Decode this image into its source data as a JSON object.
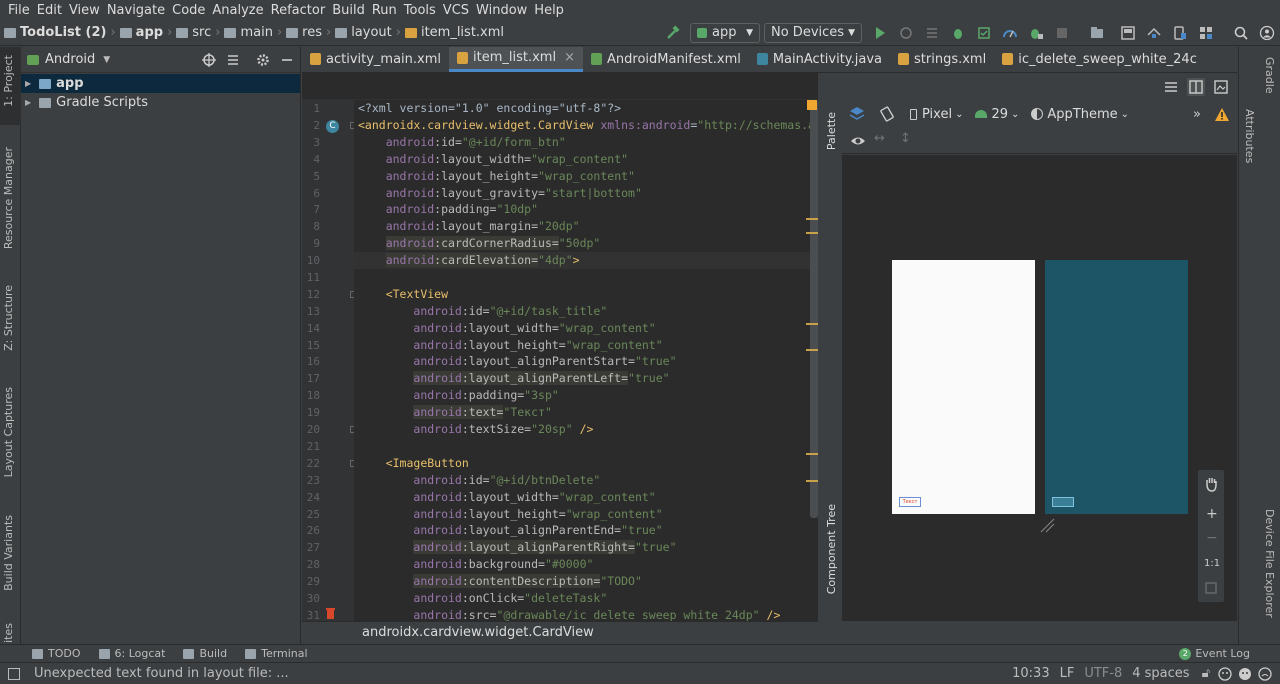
{
  "menu": [
    "File",
    "Edit",
    "View",
    "Navigate",
    "Code",
    "Analyze",
    "Refactor",
    "Build",
    "Run",
    "Tools",
    "VCS",
    "Window",
    "Help"
  ],
  "nav": {
    "crumbs": [
      "TodoList (2)",
      "app",
      "src",
      "main",
      "res",
      "layout",
      "item_list.xml"
    ],
    "run_config": "app",
    "devices": "No Devices"
  },
  "left_tabs": [
    "1: Project",
    "Resource Manager",
    "Z: Structure",
    "Layout Captures",
    "Build Variants",
    "ites"
  ],
  "project": {
    "view_label": "Android",
    "tree": [
      {
        "label": "app",
        "bold": true
      },
      {
        "label": "Gradle Scripts",
        "bold": false
      }
    ]
  },
  "tabs": [
    {
      "label": "activity_main.xml",
      "color": "#d8a241"
    },
    {
      "label": "item_list.xml",
      "color": "#d8a241",
      "active": true
    },
    {
      "label": "AndroidManifest.xml",
      "color": "#62a155"
    },
    {
      "label": "MainActivity.java",
      "color": "#3e86a0"
    },
    {
      "label": "strings.xml",
      "color": "#d8a241"
    },
    {
      "label": "ic_delete_sweep_white_24c",
      "color": "#d8a241"
    }
  ],
  "code_lines": [
    {
      "n": "1",
      "parts": [
        [
          "pl",
          "<?xml version=\"1.0\" encoding=\"utf-8\"?>"
        ]
      ]
    },
    {
      "n": "2",
      "parts": [
        [
          "tg",
          "<androidx.cardview.widget.CardView "
        ],
        [
          "ns",
          "xmlns:android"
        ],
        [
          "pl",
          "="
        ],
        [
          "str",
          "\"http://schemas.andro"
        ]
      ]
    },
    {
      "n": "3",
      "parts": [
        [
          "pl",
          "    "
        ],
        [
          "ns",
          "android"
        ],
        [
          "at",
          ":id="
        ],
        [
          "str",
          "\"@+id/form_btn\""
        ]
      ]
    },
    {
      "n": "4",
      "parts": [
        [
          "pl",
          "    "
        ],
        [
          "ns",
          "android"
        ],
        [
          "at",
          ":layout_width="
        ],
        [
          "str",
          "\"wrap_content\""
        ]
      ]
    },
    {
      "n": "5",
      "parts": [
        [
          "pl",
          "    "
        ],
        [
          "ns",
          "android"
        ],
        [
          "at",
          ":layout_height="
        ],
        [
          "str",
          "\"wrap_content\""
        ]
      ]
    },
    {
      "n": "6",
      "parts": [
        [
          "pl",
          "    "
        ],
        [
          "ns",
          "android"
        ],
        [
          "at",
          ":layout_gravity="
        ],
        [
          "str",
          "\"start|bottom\""
        ]
      ]
    },
    {
      "n": "7",
      "parts": [
        [
          "pl",
          "    "
        ],
        [
          "ns",
          "android"
        ],
        [
          "at",
          ":padding="
        ],
        [
          "str",
          "\"10dp\""
        ]
      ]
    },
    {
      "n": "8",
      "parts": [
        [
          "pl",
          "    "
        ],
        [
          "ns",
          "android"
        ],
        [
          "at",
          ":layout_margin="
        ],
        [
          "str",
          "\"20dp\""
        ]
      ]
    },
    {
      "n": "9",
      "parts": [
        [
          "pl",
          "    "
        ],
        [
          "ns",
          "android"
        ],
        [
          "at",
          ":cardCornerRadius="
        ],
        [
          "str",
          "\"50dp\""
        ]
      ],
      "hl": true
    },
    {
      "n": "10",
      "parts": [
        [
          "pl",
          "    "
        ],
        [
          "ns",
          "android"
        ],
        [
          "at",
          ":cardElevation="
        ],
        [
          "str",
          "\"4dp\""
        ],
        [
          "tg",
          ">"
        ]
      ],
      "hl": true
    },
    {
      "n": "11",
      "parts": []
    },
    {
      "n": "12",
      "parts": [
        [
          "pl",
          "    "
        ],
        [
          "tg",
          "<TextView"
        ]
      ]
    },
    {
      "n": "13",
      "parts": [
        [
          "pl",
          "        "
        ],
        [
          "ns",
          "android"
        ],
        [
          "at",
          ":id="
        ],
        [
          "str",
          "\"@+id/task_title\""
        ]
      ]
    },
    {
      "n": "14",
      "parts": [
        [
          "pl",
          "        "
        ],
        [
          "ns",
          "android"
        ],
        [
          "at",
          ":layout_width="
        ],
        [
          "str",
          "\"wrap_content\""
        ]
      ]
    },
    {
      "n": "15",
      "parts": [
        [
          "pl",
          "        "
        ],
        [
          "ns",
          "android"
        ],
        [
          "at",
          ":layout_height="
        ],
        [
          "str",
          "\"wrap_content\""
        ]
      ]
    },
    {
      "n": "16",
      "parts": [
        [
          "pl",
          "        "
        ],
        [
          "ns",
          "android"
        ],
        [
          "at",
          ":layout_alignParentStart="
        ],
        [
          "str",
          "\"true\""
        ]
      ]
    },
    {
      "n": "17",
      "parts": [
        [
          "pl",
          "        "
        ],
        [
          "ns",
          "android"
        ],
        [
          "at",
          ":layout_alignParentLeft="
        ],
        [
          "str",
          "\"true\""
        ]
      ],
      "hl": true
    },
    {
      "n": "18",
      "parts": [
        [
          "pl",
          "        "
        ],
        [
          "ns",
          "android"
        ],
        [
          "at",
          ":padding="
        ],
        [
          "str",
          "\"3sp\""
        ]
      ]
    },
    {
      "n": "19",
      "parts": [
        [
          "pl",
          "        "
        ],
        [
          "ns",
          "android"
        ],
        [
          "at",
          ":text="
        ],
        [
          "str",
          "\"Текст\""
        ]
      ],
      "hl": true
    },
    {
      "n": "20",
      "parts": [
        [
          "pl",
          "        "
        ],
        [
          "ns",
          "android"
        ],
        [
          "at",
          ":textSize="
        ],
        [
          "str",
          "\"20sp\""
        ],
        [
          "tg",
          " />"
        ]
      ]
    },
    {
      "n": "21",
      "parts": []
    },
    {
      "n": "22",
      "parts": [
        [
          "pl",
          "    "
        ],
        [
          "tg",
          "<ImageButton"
        ]
      ]
    },
    {
      "n": "23",
      "parts": [
        [
          "pl",
          "        "
        ],
        [
          "ns",
          "android"
        ],
        [
          "at",
          ":id="
        ],
        [
          "str",
          "\"@+id/btnDelete\""
        ]
      ]
    },
    {
      "n": "24",
      "parts": [
        [
          "pl",
          "        "
        ],
        [
          "ns",
          "android"
        ],
        [
          "at",
          ":layout_width="
        ],
        [
          "str",
          "\"wrap_content\""
        ]
      ]
    },
    {
      "n": "25",
      "parts": [
        [
          "pl",
          "        "
        ],
        [
          "ns",
          "android"
        ],
        [
          "at",
          ":layout_height="
        ],
        [
          "str",
          "\"wrap_content\""
        ]
      ]
    },
    {
      "n": "26",
      "parts": [
        [
          "pl",
          "        "
        ],
        [
          "ns",
          "android"
        ],
        [
          "at",
          ":layout_alignParentEnd="
        ],
        [
          "str",
          "\"true\""
        ]
      ]
    },
    {
      "n": "27",
      "parts": [
        [
          "pl",
          "        "
        ],
        [
          "ns",
          "android"
        ],
        [
          "at",
          ":layout_alignParentRight="
        ],
        [
          "str",
          "\"true\""
        ]
      ],
      "hl": true
    },
    {
      "n": "28",
      "parts": [
        [
          "pl",
          "        "
        ],
        [
          "ns",
          "android"
        ],
        [
          "at",
          ":background="
        ],
        [
          "str",
          "\"#0000\""
        ]
      ]
    },
    {
      "n": "29",
      "parts": [
        [
          "pl",
          "        "
        ],
        [
          "ns",
          "android"
        ],
        [
          "at",
          ":contentDescription="
        ],
        [
          "str",
          "\"TODO\""
        ]
      ],
      "hl": true
    },
    {
      "n": "30",
      "parts": [
        [
          "pl",
          "        "
        ],
        [
          "ns",
          "android"
        ],
        [
          "at",
          ":onClick="
        ],
        [
          "str",
          "\"deleteTask\""
        ]
      ]
    },
    {
      "n": "31",
      "parts": [
        [
          "pl",
          "        "
        ],
        [
          "ns",
          "android"
        ],
        [
          "at",
          ":src="
        ],
        [
          "str",
          "\"@drawable/ic_delete_sweep_white_24dp\""
        ],
        [
          "tg",
          " />"
        ]
      ]
    }
  ],
  "editor_breadcrumb": "androidx.cardview.widget.CardView",
  "palette_label": "Palette",
  "component_tree_label": "Component Tree",
  "design": {
    "device": "Pixel",
    "api": "29",
    "theme": "AppTheme",
    "zoom_one": "1:1",
    "preview_text": "Текст",
    "blueprint_color": "#1d5466"
  },
  "right_tabs": [
    "Gradle",
    "Attributes",
    "Device File Explorer"
  ],
  "bottom_tools": [
    {
      "label": "TODO"
    },
    {
      "label": "6: Logcat"
    },
    {
      "label": "Build"
    },
    {
      "label": "Terminal"
    }
  ],
  "event_log": {
    "label": "Event Log",
    "count": "2"
  },
  "status": {
    "message": "Unexpected text found in layout file: ...",
    "position": "10:33",
    "line_sep": "LF",
    "encoding": "UTF-8",
    "indent": "4 spaces"
  },
  "colors": {
    "accent": "#4a88c7",
    "run": "#59a869",
    "warning": "#f0a732"
  }
}
